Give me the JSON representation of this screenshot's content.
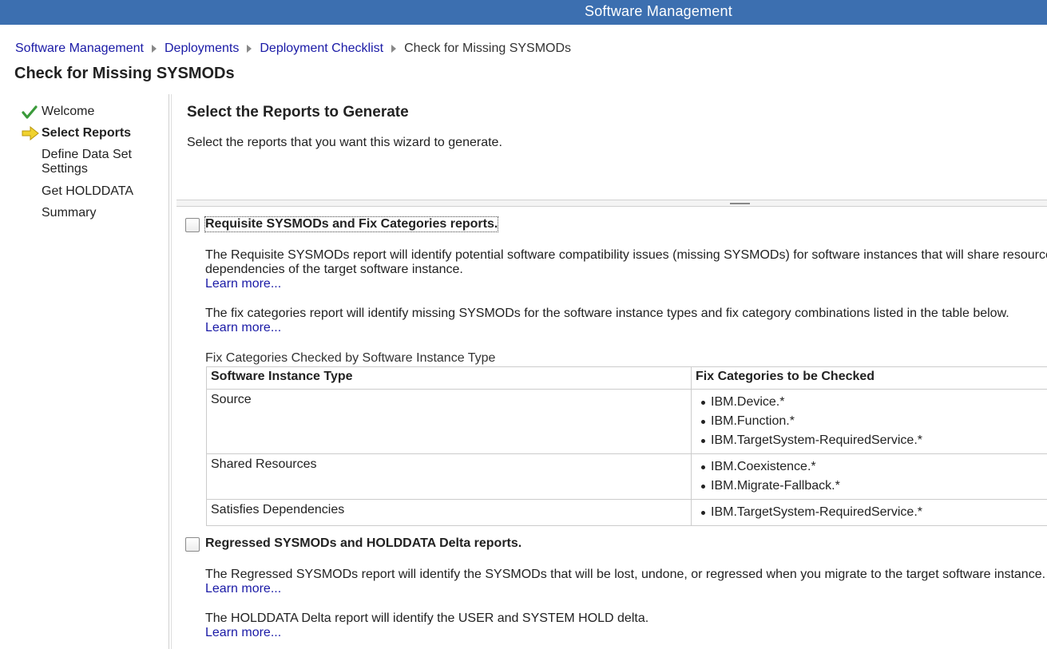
{
  "header": {
    "title": "Software Management"
  },
  "breadcrumb": {
    "items": [
      "Software Management",
      "Deployments",
      "Deployment Checklist"
    ],
    "current": "Check for Missing SYSMODs"
  },
  "page": {
    "title": "Check for Missing SYSMODs"
  },
  "steps": [
    {
      "label": "Welcome",
      "status": "completed",
      "icon": "check-icon"
    },
    {
      "label": "Select Reports",
      "status": "current",
      "icon": "arrow-right-icon"
    },
    {
      "label": "Define Data Set Settings",
      "status": "pending"
    },
    {
      "label": "Get HOLDDATA",
      "status": "pending"
    },
    {
      "label": "Summary",
      "status": "pending"
    }
  ],
  "main": {
    "title": "Select the Reports to Generate",
    "description": "Select the reports that you want this wizard to generate."
  },
  "option1": {
    "label": "Requisite SYSMODs and Fix Categories reports.",
    "checked": false,
    "para1_line1": "The Requisite SYSMODs report will identify potential software compatibility issues (missing SYSMODs) for software instances that will share resources with",
    "para1_line2": "dependencies of the target software instance.",
    "learn_more_1": "Learn more...",
    "para2": "The fix categories report will identify missing SYSMODs for the software instance types and fix category combinations listed in the table below.",
    "learn_more_2": "Learn more..."
  },
  "fix_table": {
    "caption": "Fix Categories Checked by Software Instance Type",
    "columns": [
      "Software Instance Type",
      "Fix Categories to be Checked"
    ],
    "rows": [
      {
        "type": "Source",
        "categories": [
          "IBM.Device.*",
          "IBM.Function.*",
          "IBM.TargetSystem-RequiredService.*"
        ]
      },
      {
        "type": "Shared Resources",
        "categories": [
          "IBM.Coexistence.*",
          "IBM.Migrate-Fallback.*"
        ]
      },
      {
        "type": "Satisfies Dependencies",
        "categories": [
          "IBM.TargetSystem-RequiredService.*"
        ]
      }
    ]
  },
  "option2": {
    "label": "Regressed SYSMODs and HOLDDATA Delta reports.",
    "checked": false,
    "para1": "The Regressed SYSMODs report will identify the SYSMODs that will be lost, undone, or regressed when you migrate to the target software instance.",
    "learn_more_1": "Learn more...",
    "para2": "The HOLDDATA Delta report will identify the USER and SYSTEM HOLD delta.",
    "learn_more_2": "Learn more..."
  },
  "colors": {
    "header_bar": "#3c6fb0",
    "link": "#1a1aa6",
    "check": "#3a9a3a",
    "arrow": "#f0d22e"
  }
}
